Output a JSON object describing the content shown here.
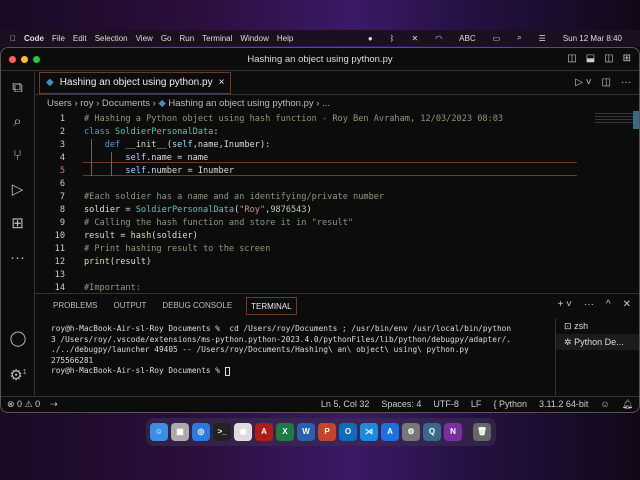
{
  "menubar": {
    "app": "Code",
    "items": [
      "File",
      "Edit",
      "Selection",
      "View",
      "Go",
      "Run",
      "Terminal",
      "Window",
      "Help"
    ],
    "input_source": "ABC",
    "clock": "Sun 12 Mar  8:40"
  },
  "window": {
    "title": "Hashing an object using python.py"
  },
  "tab": {
    "label": "Hashing an object using python.py"
  },
  "breadcrumb": [
    "Users",
    "roy",
    "Documents",
    "Hashing an object using python.py",
    "..."
  ],
  "editor": {
    "current_line": 5,
    "lines": [
      [
        [
          "# Hashing a Python object using hash function - Roy Ben Avraham, 12/03/2023 08:03",
          "c"
        ]
      ],
      [
        [
          "class ",
          "k"
        ],
        [
          "SoldierPersonalData",
          "t"
        ],
        [
          ":",
          ""
        ]
      ],
      [
        [
          "    def ",
          "k"
        ],
        [
          "__init__",
          "f"
        ],
        [
          "(",
          ""
        ],
        [
          "self",
          "s"
        ],
        [
          ",name,Inumber):",
          ""
        ]
      ],
      [
        [
          "        self",
          "s"
        ],
        [
          ".name = name",
          ""
        ]
      ],
      [
        [
          "        self",
          "s"
        ],
        [
          ".number = Inumber",
          ""
        ]
      ],
      [],
      [
        [
          "#Each soldier has a name and an identifying/private number",
          "c"
        ]
      ],
      [
        [
          "soldier = ",
          ""
        ],
        [
          "SoldierPersonalData",
          "t"
        ],
        [
          "(",
          ""
        ],
        [
          "\"Roy\"",
          "st"
        ],
        [
          ",",
          ""
        ],
        [
          "9876543",
          "n"
        ],
        [
          ")",
          ""
        ]
      ],
      [
        [
          "# Calling the hash function and store it in \"result\"",
          "c"
        ]
      ],
      [
        [
          "result = ",
          ""
        ],
        [
          "hash",
          "f"
        ],
        [
          "(soldier)",
          ""
        ]
      ],
      [
        [
          "# Print hashing result to the screen",
          "c"
        ]
      ],
      [
        [
          "print",
          "f"
        ],
        [
          "(result)",
          ""
        ]
      ],
      [],
      [
        [
          "#Important:",
          "c"
        ]
      ]
    ]
  },
  "panel": {
    "tabs": [
      "PROBLEMS",
      "OUTPUT",
      "DEBUG CONSOLE",
      "TERMINAL"
    ],
    "active_tab": "TERMINAL",
    "terminal": [
      "roy@h-MacBook-Air-sl-Roy Documents %  cd /Users/roy/Documents ; /usr/bin/env /usr/local/bin/python",
      "3 /Users/roy/.vscode/extensions/ms-python.python-2023.4.0/pythonFiles/lib/python/debugpy/adapter/.",
      "./../debugpy/launcher 49405 -- /Users/roy/Documents/Hashing\\ an\\ object\\ using\\ python.py",
      "275566281"
    ],
    "prompt": "roy@h-MacBook-Air-sl-Roy Documents % ",
    "terminals": [
      "zsh",
      "Python De..."
    ]
  },
  "status": {
    "errors": "0",
    "warnings": "0",
    "position": "Ln 5, Col 32",
    "spaces": "Spaces: 4",
    "encoding": "UTF-8",
    "eol": "LF",
    "language": "Python",
    "interpreter": "3.11.2 64-bit",
    "settings_badge": "1"
  },
  "dock": [
    "Finder",
    "Launchpad",
    "Safari",
    "Terminal",
    "Screenshot",
    "Acrobat",
    "Excel",
    "Word",
    "PowerPoint",
    "Outlook",
    "VS Code",
    "App Store",
    "System Settings",
    "QuickTime",
    "OneNote",
    "Trash"
  ]
}
